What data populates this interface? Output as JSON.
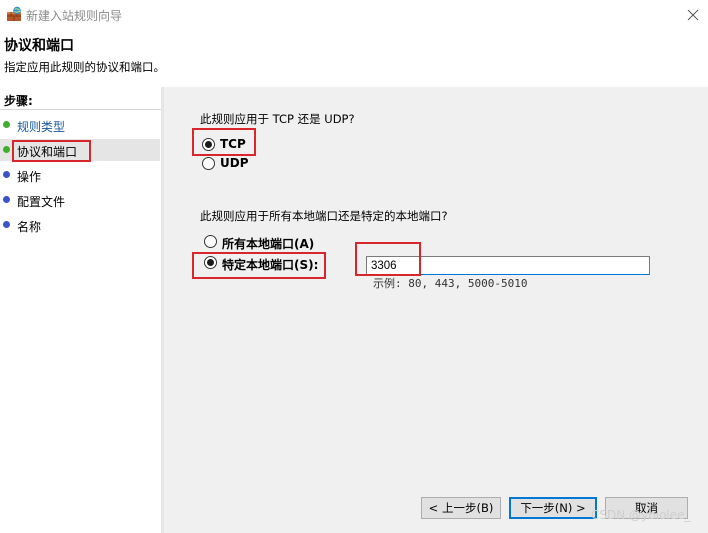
{
  "window": {
    "title": "新建入站规则向导"
  },
  "header": {
    "title": "协议和端口",
    "subtitle": "指定应用此规则的协议和端口。"
  },
  "sidebar": {
    "heading": "步骤:",
    "items": [
      {
        "label": "规则类型",
        "dot_color": "#3fae2a",
        "label_color": "#1a5aa0"
      },
      {
        "label": "协议和端口",
        "dot_color": "#3fae2a",
        "label_color": "#000000"
      },
      {
        "label": "操作",
        "dot_color": "#3b53c9",
        "label_color": "#000000"
      },
      {
        "label": "配置文件",
        "dot_color": "#3b53c9",
        "label_color": "#000000"
      },
      {
        "label": "名称",
        "dot_color": "#3b53c9",
        "label_color": "#000000"
      }
    ]
  },
  "main": {
    "protocol_question": "此规则应用于 TCP 还是 UDP?",
    "protocol_options": [
      {
        "label": "TCP",
        "checked": true
      },
      {
        "label": "UDP",
        "checked": false
      }
    ],
    "port_question": "此规则应用于所有本地端口还是特定的本地端口?",
    "port_options": [
      {
        "label": "所有本地端口(A)",
        "checked": false
      },
      {
        "label": "特定本地端口(S):",
        "checked": true
      }
    ],
    "port_value": "3306",
    "port_hint": "示例: 80, 443, 5000-5010"
  },
  "buttons": {
    "back": "< 上一步(B)",
    "next": "下一步(N) >",
    "cancel": "取消"
  },
  "watermark": "CSDN @ybiolee_",
  "colors": {
    "highlight_box": "#d9262c",
    "focus_accent": "#0078d7"
  }
}
